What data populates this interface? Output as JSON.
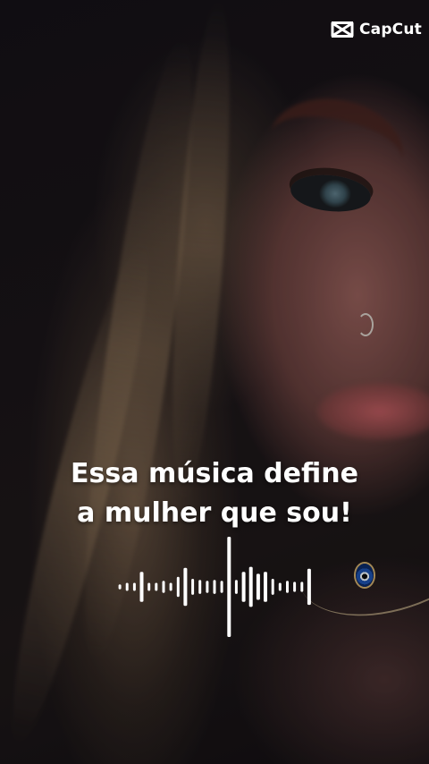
{
  "watermark": {
    "brand": "CapCut",
    "icon": "capcut-logo-icon",
    "color": "#ffffff"
  },
  "caption": {
    "line1": "Essa música define",
    "line2": "a mulher que sou!",
    "color": "#ffffff"
  },
  "waveform": {
    "icon": "audio-waveform-icon",
    "color": "#ffffff",
    "bar_levels": [
      0.05,
      0.08,
      0.08,
      0.3,
      0.08,
      0.08,
      0.12,
      0.08,
      0.2,
      0.38,
      0.16,
      0.14,
      0.12,
      0.14,
      0.12,
      1.0,
      0.14,
      0.3,
      0.4,
      0.26,
      0.3,
      0.16,
      0.08,
      0.12,
      0.1,
      0.1,
      0.36
    ]
  }
}
